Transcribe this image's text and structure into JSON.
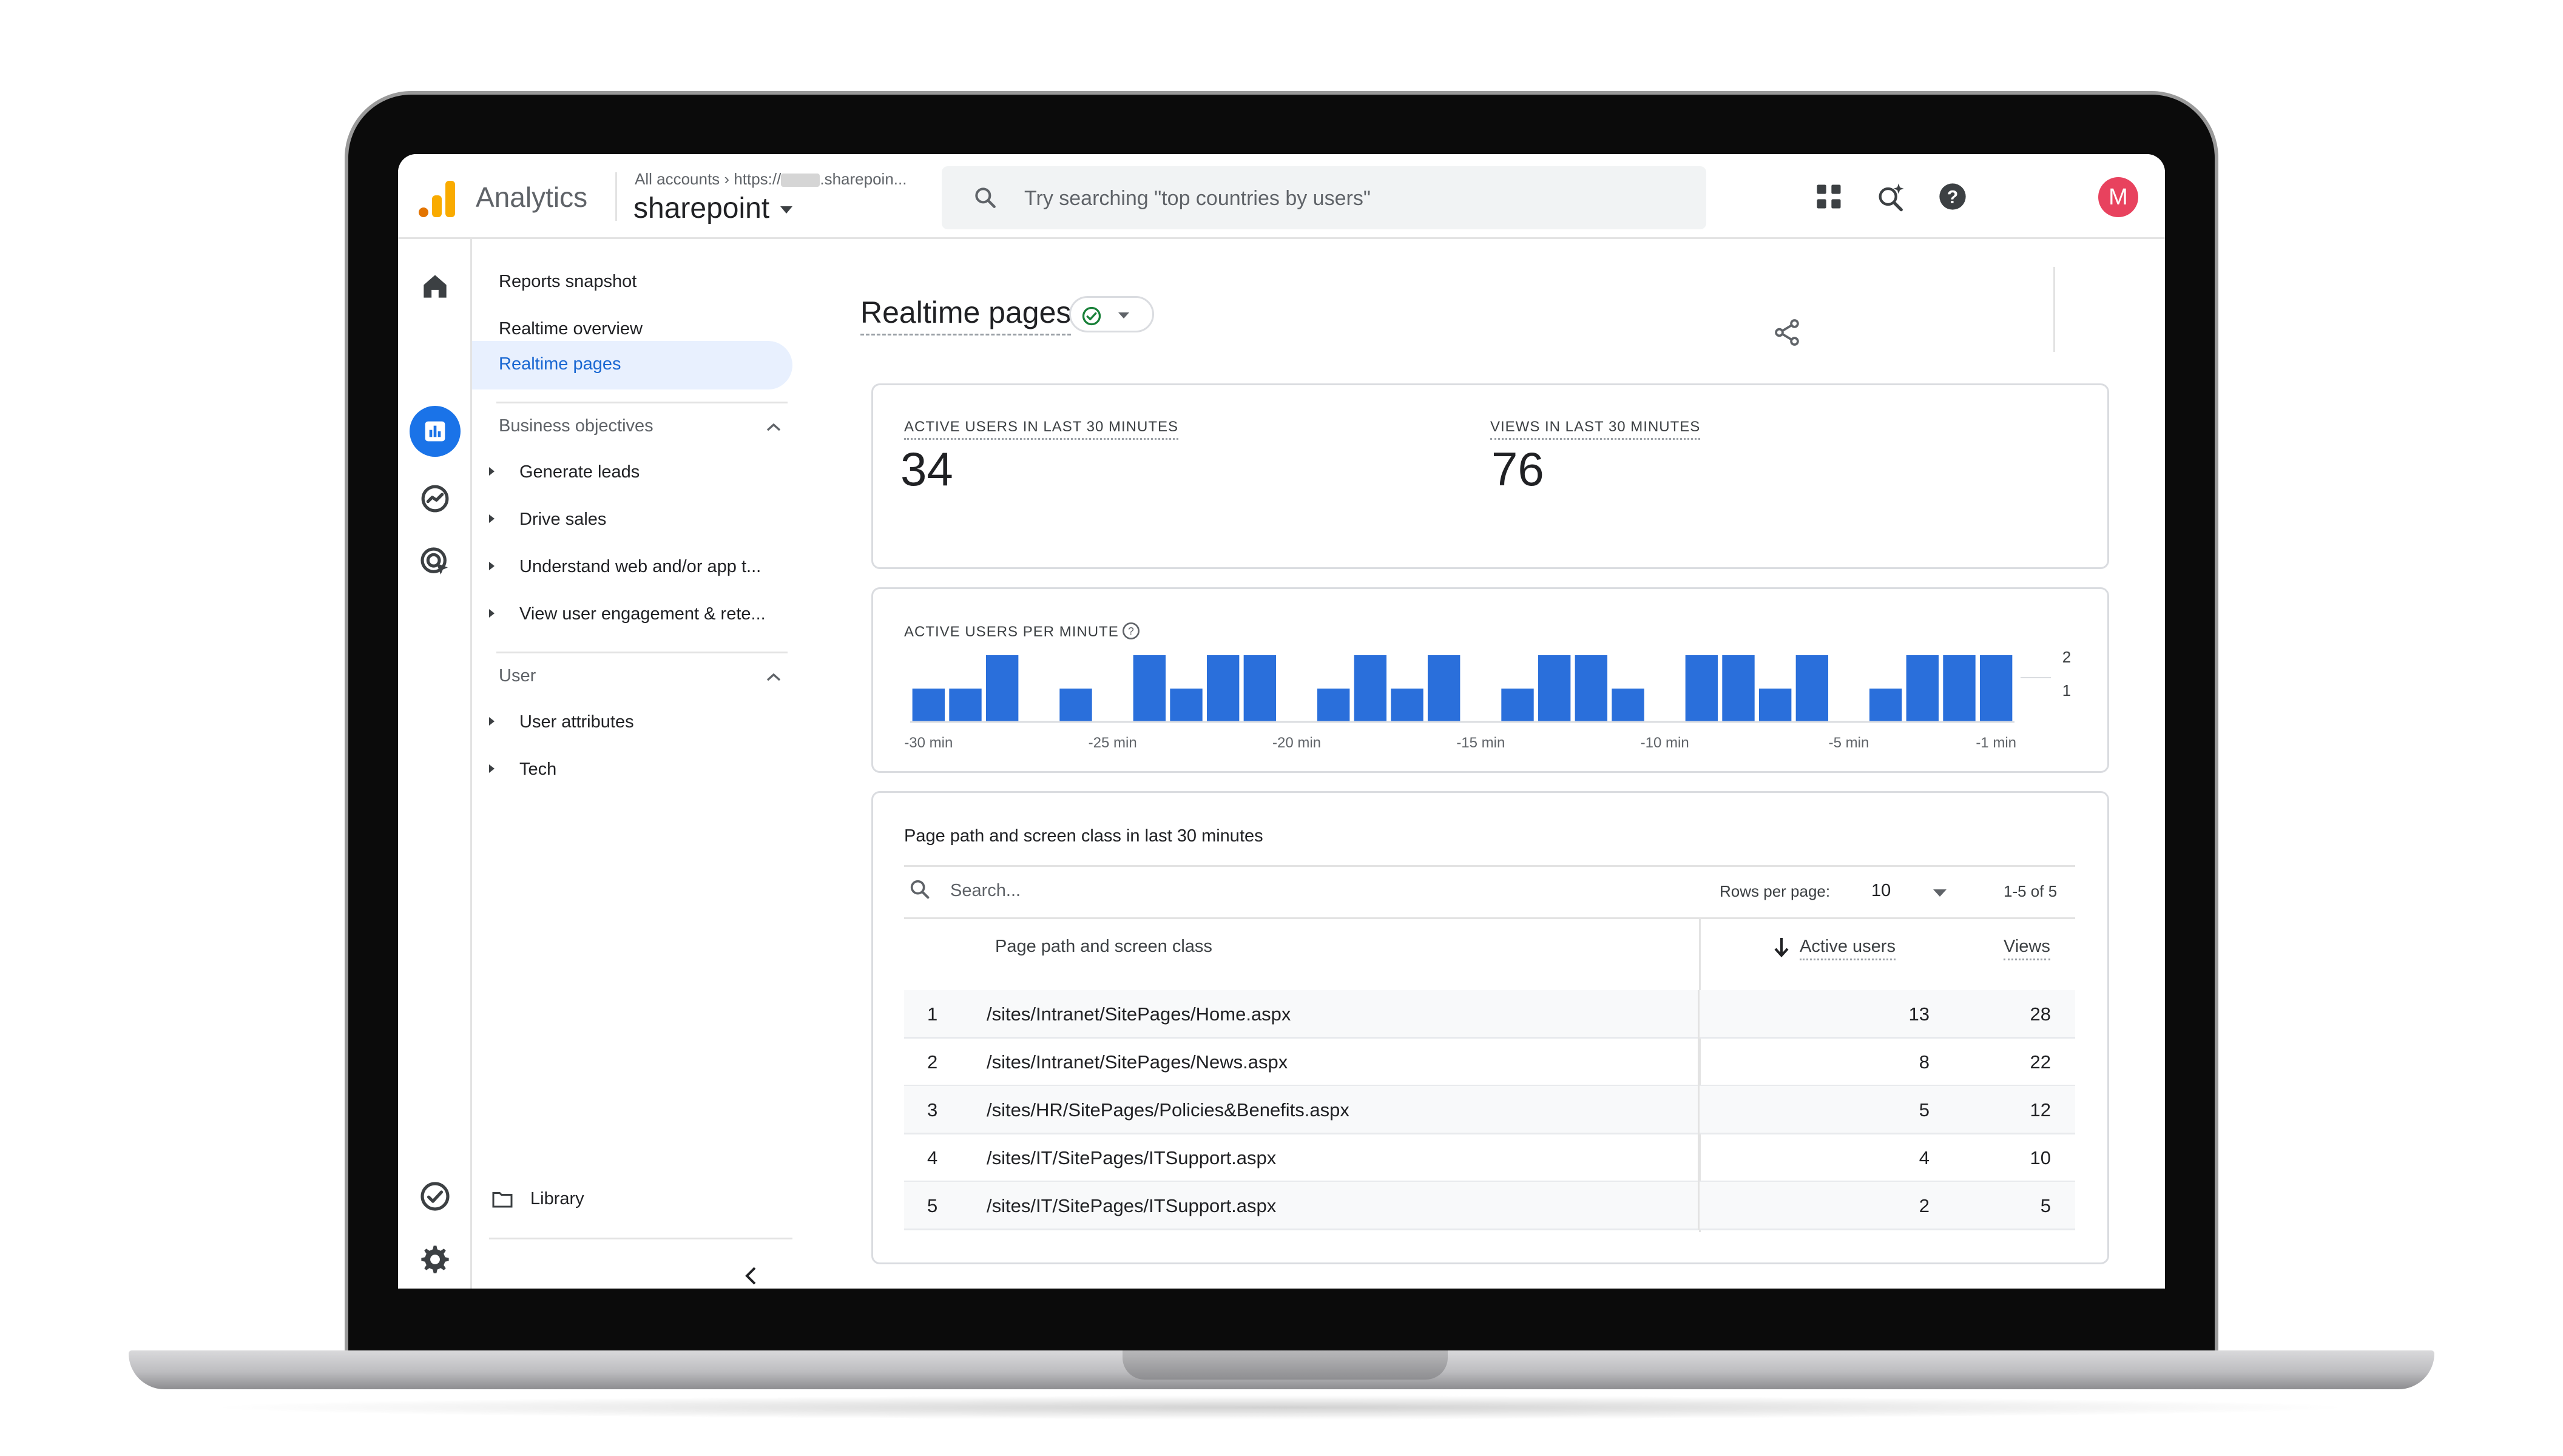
{
  "app": {
    "name": "Analytics",
    "breadcrumb_prefix": "All accounts",
    "breadcrumb_url_start": "https://",
    "breadcrumb_url_end": ".sharepoin...",
    "property": "sharepoint"
  },
  "search": {
    "placeholder": "Try searching \"top countries by users\""
  },
  "user": {
    "avatar_letter": "M"
  },
  "icons": {
    "apps": "apps-grid-icon",
    "insights": "search-insights-icon",
    "help": "help-icon",
    "home": "home-icon",
    "reports": "bar-chart-icon",
    "explore": "explore-icon",
    "advertising": "advertising-icon",
    "admin": "gear-icon",
    "configure": "check-circle-icon",
    "library": "folder-icon",
    "collapse": "chevron-left-icon",
    "share": "share-icon"
  },
  "colors": {
    "accent": "#1a73e8",
    "bar": "#2a6fdb",
    "avatar": "#e8425e",
    "status_ok": "#188038"
  },
  "nav": {
    "items": [
      "Reports snapshot",
      "Realtime overview",
      "Realtime pages"
    ],
    "active": "Realtime pages",
    "sections": [
      {
        "title": "Business objectives",
        "items": [
          "Generate leads",
          "Drive sales",
          "Understand web and/or app t...",
          "View user engagement & rete..."
        ]
      },
      {
        "title": "User",
        "items": [
          "User attributes",
          "Tech"
        ]
      }
    ],
    "library": "Library"
  },
  "page": {
    "title": "Realtime pages"
  },
  "metrics": [
    {
      "label": "ACTIVE USERS IN LAST 30 MINUTES",
      "value": "34"
    },
    {
      "label": "VIEWS IN LAST 30 MINUTES",
      "value": "76"
    }
  ],
  "chart_data": {
    "type": "bar",
    "title": "ACTIVE USERS PER MINUTE",
    "x_tick_labels": [
      "-30 min",
      "-25 min",
      "-20 min",
      "-15 min",
      "-10 min",
      "-5 min",
      "-1 min"
    ],
    "x_tick_positions": [
      -30,
      -25,
      -20,
      -15,
      -10,
      -5,
      -1
    ],
    "x": [
      -30,
      -29,
      -28,
      -27,
      -26,
      -25,
      -24,
      -23,
      -22,
      -21,
      -20,
      -19,
      -18,
      -17,
      -16,
      -15,
      -14,
      -13,
      -12,
      -11,
      -10,
      -9,
      -8,
      -7,
      -6,
      -5,
      -4,
      -3,
      -2,
      -1
    ],
    "values": [
      1,
      1,
      2,
      0,
      1,
      0,
      2,
      1,
      2,
      2,
      0,
      1,
      2,
      1,
      2,
      0,
      1,
      2,
      2,
      1,
      0,
      2,
      2,
      1,
      2,
      0,
      1,
      2,
      2,
      2
    ],
    "ylim": [
      0,
      2
    ],
    "y_tick_labels": [
      "2",
      "1"
    ],
    "grid": false
  },
  "table": {
    "title": "Page path and screen class in last 30 minutes",
    "search_placeholder": "Search...",
    "rows_per_page_label": "Rows per page:",
    "rows_per_page": "10",
    "pagination": "1-5 of 5",
    "columns": [
      "Page path and screen class",
      "Active users",
      "Views"
    ],
    "rows": [
      {
        "rank": "1",
        "path": "/sites/Intranet/SitePages/Home.aspx",
        "active_users": "13",
        "views": "28"
      },
      {
        "rank": "2",
        "path": "/sites/Intranet/SitePages/News.aspx",
        "active_users": "8",
        "views": "22"
      },
      {
        "rank": "3",
        "path": "/sites/HR/SitePages/Policies&Benefits.aspx",
        "active_users": "5",
        "views": "12"
      },
      {
        "rank": "4",
        "path": "/sites/IT/SitePages/ITSupport.aspx",
        "active_users": "4",
        "views": "10"
      },
      {
        "rank": "5",
        "path": "/sites/IT/SitePages/ITSupport.aspx",
        "active_users": "2",
        "views": "5"
      }
    ]
  }
}
